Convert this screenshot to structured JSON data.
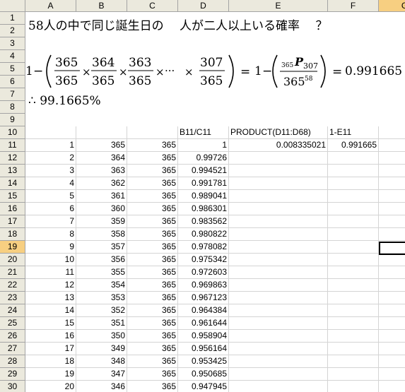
{
  "columns": [
    "A",
    "B",
    "C",
    "D",
    "E",
    "F",
    "G"
  ],
  "selected_column": "G",
  "selected_row": "19",
  "row_numbers": [
    "1",
    "2",
    "3",
    "4",
    "5",
    "6",
    "7",
    "8",
    "9",
    "10",
    "11",
    "12",
    "13",
    "14",
    "15",
    "16",
    "17",
    "18",
    "19",
    "20",
    "21",
    "22",
    "23",
    "24",
    "25",
    "26",
    "27",
    "28",
    "29",
    "30"
  ],
  "title_text": "58人の中で同じ誕生日の　 人が二人以上いる確率　 ？",
  "therefore_text": "∴ 99.1665%",
  "formula": {
    "one": "1",
    "minus": "−",
    "terms": [
      {
        "num": "365",
        "den": "365"
      },
      {
        "num": "364",
        "den": "365"
      },
      {
        "num": "363",
        "den": "365"
      },
      {
        "num": "307",
        "den": "365"
      }
    ],
    "times": "×",
    "dots": "···",
    "equals": "=",
    "perm_pre": "365",
    "perm_P": "P",
    "perm_sub": "307",
    "perm_den_base": "365",
    "perm_den_exp": "58",
    "result": "0.991665"
  },
  "headers_row10": {
    "D": "B11/C11",
    "E": "PRODUCT(D11:D68)",
    "F": "1-E11"
  },
  "row11_extra": {
    "E": "0.008335021",
    "F": "0.991665"
  },
  "table_rows": [
    {
      "a": "1",
      "b": "365",
      "c": "365",
      "d": "1"
    },
    {
      "a": "2",
      "b": "364",
      "c": "365",
      "d": "0.99726"
    },
    {
      "a": "3",
      "b": "363",
      "c": "365",
      "d": "0.994521"
    },
    {
      "a": "4",
      "b": "362",
      "c": "365",
      "d": "0.991781"
    },
    {
      "a": "5",
      "b": "361",
      "c": "365",
      "d": "0.989041"
    },
    {
      "a": "6",
      "b": "360",
      "c": "365",
      "d": "0.986301"
    },
    {
      "a": "7",
      "b": "359",
      "c": "365",
      "d": "0.983562"
    },
    {
      "a": "8",
      "b": "358",
      "c": "365",
      "d": "0.980822"
    },
    {
      "a": "9",
      "b": "357",
      "c": "365",
      "d": "0.978082"
    },
    {
      "a": "10",
      "b": "356",
      "c": "365",
      "d": "0.975342"
    },
    {
      "a": "11",
      "b": "355",
      "c": "365",
      "d": "0.972603"
    },
    {
      "a": "12",
      "b": "354",
      "c": "365",
      "d": "0.969863"
    },
    {
      "a": "13",
      "b": "353",
      "c": "365",
      "d": "0.967123"
    },
    {
      "a": "14",
      "b": "352",
      "c": "365",
      "d": "0.964384"
    },
    {
      "a": "15",
      "b": "351",
      "c": "365",
      "d": "0.961644"
    },
    {
      "a": "16",
      "b": "350",
      "c": "365",
      "d": "0.958904"
    },
    {
      "a": "17",
      "b": "349",
      "c": "365",
      "d": "0.956164"
    },
    {
      "a": "18",
      "b": "348",
      "c": "365",
      "d": "0.953425"
    },
    {
      "a": "19",
      "b": "347",
      "c": "365",
      "d": "0.950685"
    },
    {
      "a": "20",
      "b": "346",
      "c": "365",
      "d": "0.947945"
    }
  ]
}
